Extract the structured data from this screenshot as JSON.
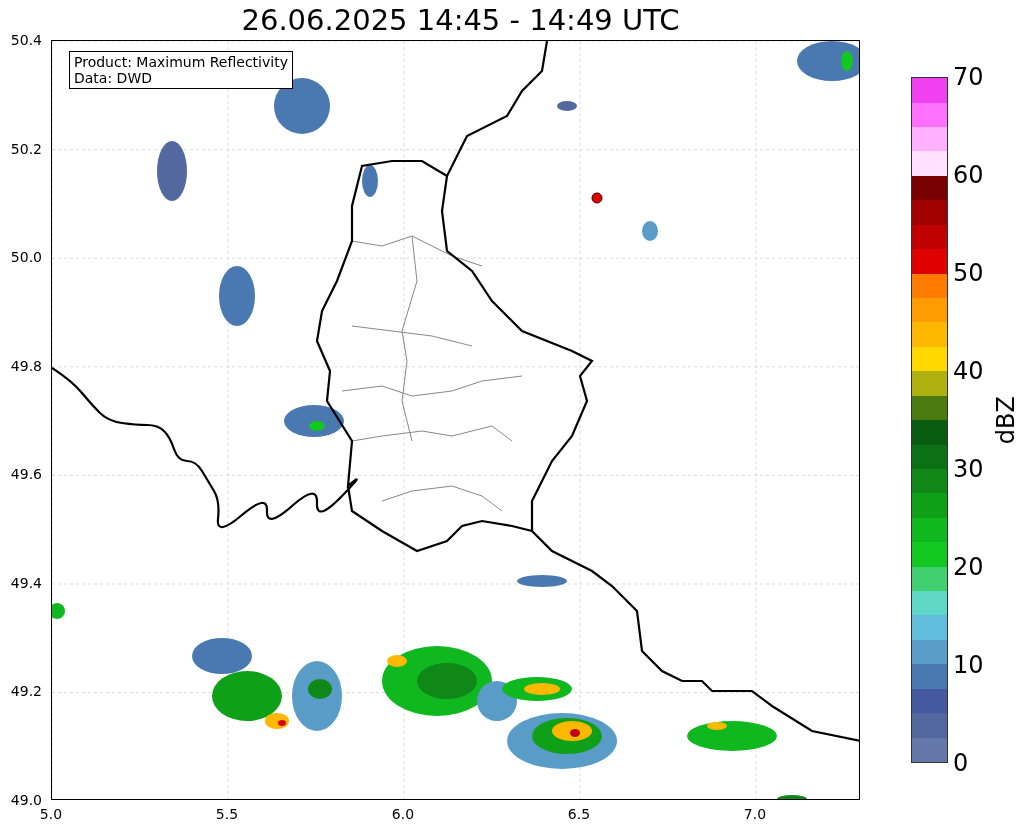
{
  "title": "26.06.2025 14:45 - 14:49 UTC",
  "map": {
    "annotation": [
      "Product: Maximum Reflectivity",
      "Data: DWD"
    ],
    "x_tick_labels": [
      "5.0",
      "5.5",
      "6.0",
      "6.5",
      "7.0"
    ],
    "y_tick_labels": [
      "50.4",
      "50.2",
      "50.0",
      "49.8",
      "49.6",
      "49.4",
      "49.2",
      "49.0"
    ]
  },
  "colorbar": {
    "label": "dBZ",
    "tick_labels": [
      "70",
      "60",
      "50",
      "40",
      "30",
      "20",
      "10",
      "0"
    ],
    "bins": [
      {
        "color": "#6577a8"
      },
      {
        "color": "#5468a0"
      },
      {
        "color": "#4458a0"
      },
      {
        "color": "#4a78b0"
      },
      {
        "color": "#5a9cc8"
      },
      {
        "color": "#62bcdc"
      },
      {
        "color": "#60d8c8"
      },
      {
        "color": "#40d070"
      },
      {
        "color": "#10c820"
      },
      {
        "color": "#10b820"
      },
      {
        "color": "#10a018"
      },
      {
        "color": "#108818"
      },
      {
        "color": "#0c7014"
      },
      {
        "color": "#0a5c10"
      },
      {
        "color": "#4a7a10"
      },
      {
        "color": "#b0b010"
      },
      {
        "color": "#ffd800"
      },
      {
        "color": "#ffb800"
      },
      {
        "color": "#ff9c00"
      },
      {
        "color": "#ff7c00"
      },
      {
        "color": "#e00000"
      },
      {
        "color": "#c00000"
      },
      {
        "color": "#a00000"
      },
      {
        "color": "#780000"
      },
      {
        "color": "#ffe0ff"
      },
      {
        "color": "#ffb0ff"
      },
      {
        "color": "#ff70ff"
      },
      {
        "color": "#f040f0"
      }
    ]
  }
}
